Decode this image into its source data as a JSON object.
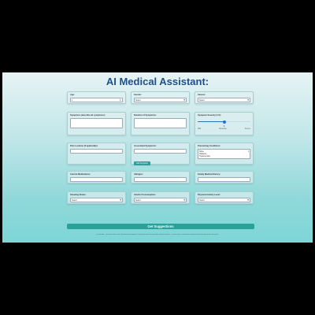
{
  "title": "AI Medical Assistant:",
  "fields": {
    "age": {
      "label": "Age:",
      "value": "1"
    },
    "gender": {
      "label": "Gender:",
      "value": "Select"
    },
    "season": {
      "label": "Season:",
      "value": "Select"
    },
    "symptoms": {
      "label": "Symptoms (describe all symptoms):",
      "value": ""
    },
    "duration": {
      "label": "Duration of Symptoms:",
      "value": ""
    },
    "severity": {
      "label": "Symptom Severity (1-5):",
      "value": "3",
      "level": 0.5,
      "scale_min": "Mild",
      "scale_mid": "Moderate",
      "scale_max": "Severe"
    },
    "pain_location": {
      "label": "Pain Location (if applicable):",
      "value": ""
    },
    "associated": {
      "label": "Associated Symptoms:",
      "value": "",
      "button": "Add Symptom"
    },
    "preexisting": {
      "label": "Preexisting Conditions:",
      "options": [
        "None",
        "Diabetes",
        "Hypertension"
      ]
    },
    "medications": {
      "label": "Current Medications:",
      "value": ""
    },
    "allergies": {
      "label": "Allergies:",
      "value": ""
    },
    "family_history": {
      "label": "Family Medical History:",
      "value": ""
    },
    "smoking": {
      "label": "Smoking Status:",
      "value": "Select"
    },
    "alcohol": {
      "label": "Alcohol Consumption:",
      "value": "Select"
    },
    "activity": {
      "label": "Physical Activity Level:",
      "value": "Select"
    }
  },
  "submit_label": "Get Suggestions",
  "disclaimer": "Disclaimer: This assistant is for informational purposes only and does not provide medical advice. Consult with a healthcare professional for any health concerns.",
  "colors": {
    "accent": "#2aa198",
    "title": "#1f4f8a",
    "slider": "#2f6fbf"
  }
}
